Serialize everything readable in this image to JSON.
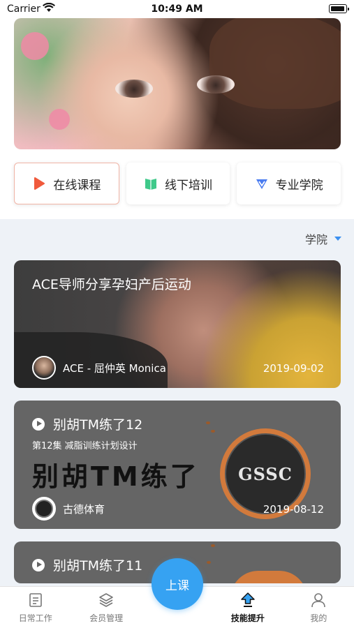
{
  "status_bar": {
    "carrier": "Carrier",
    "time": "10:49 AM"
  },
  "category_tabs": [
    {
      "label": "在线课程",
      "icon": "play-icon",
      "color": "#f05a3c"
    },
    {
      "label": "线下培训",
      "icon": "book-icon",
      "color": "#3fc98a"
    },
    {
      "label": "专业学院",
      "icon": "v-badge-icon",
      "color": "#4a7cf0"
    }
  ],
  "filter": {
    "label": "学院"
  },
  "courses": [
    {
      "title": "ACE导师分享孕妇产后运动",
      "author": "ACE - 屈仲英 Monica",
      "date": "2019-09-02"
    },
    {
      "title": "别胡TM练了12",
      "episode": "第12集 减脂训练计划设计",
      "big_text": "别胡TM练了",
      "logo_text": "GSSC",
      "author": "古德体育",
      "date": "2019-08-12"
    },
    {
      "title": "别胡TM练了11"
    }
  ],
  "bottom_nav": {
    "items": [
      {
        "label": "日常工作",
        "icon": "document-icon"
      },
      {
        "label": "会员管理",
        "icon": "layers-icon"
      },
      {
        "label": "技能提升",
        "icon": "upload-arrow-icon"
      },
      {
        "label": "我的",
        "icon": "person-icon"
      }
    ],
    "center_label": "上课",
    "accent": "#36a2f2"
  }
}
